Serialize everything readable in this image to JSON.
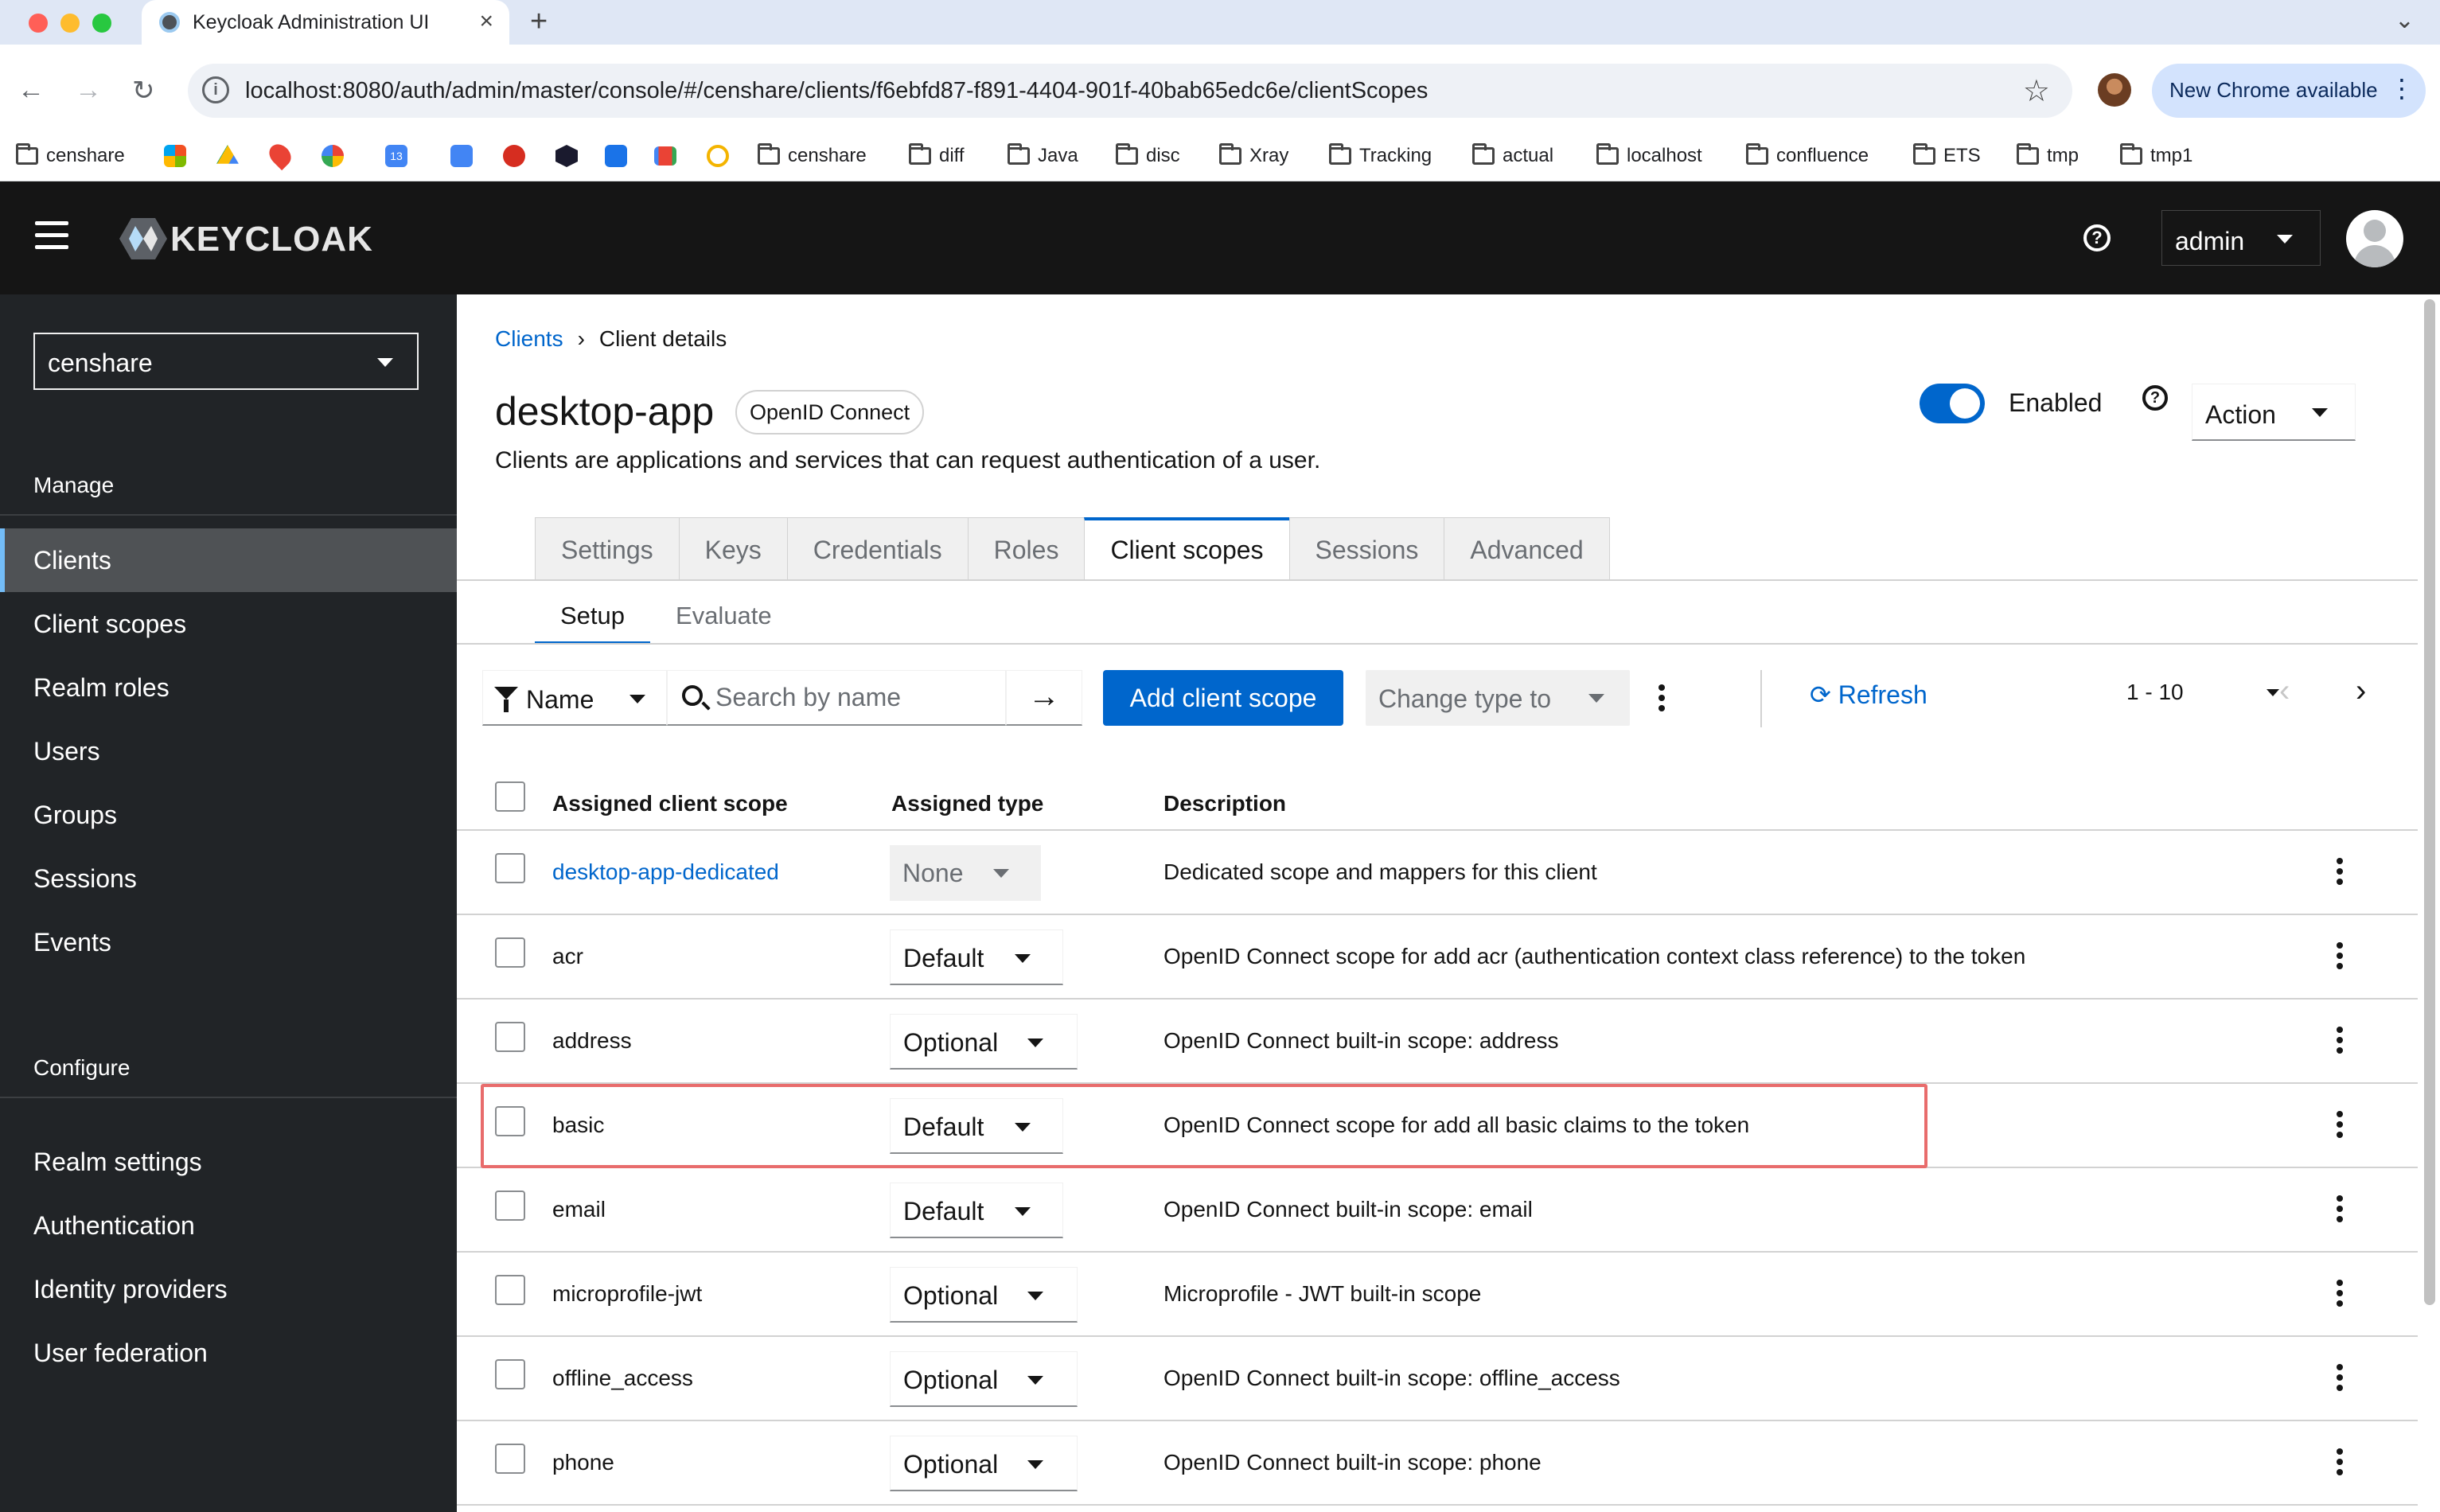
{
  "browser": {
    "tab_title": "Keycloak Administration UI",
    "url": "localhost:8080/auth/admin/master/console/#/censhare/clients/f6ebfd87-f891-4404-901f-40bab65edc6e/clientScopes",
    "update_label": "New Chrome available",
    "bookmarks": [
      "censhare",
      "censhare",
      "diff",
      "Java",
      "disc",
      "Xray",
      "Tracking",
      "actual",
      "localhost",
      "confluence",
      "ETS",
      "tmp",
      "tmp1"
    ]
  },
  "header": {
    "logo_text": "KEYCLOAK",
    "user_label": "admin"
  },
  "sidebar": {
    "realm": "censhare",
    "manage_label": "Manage",
    "manage_items": [
      "Clients",
      "Client scopes",
      "Realm roles",
      "Users",
      "Groups",
      "Sessions",
      "Events"
    ],
    "configure_label": "Configure",
    "configure_items": [
      "Realm settings",
      "Authentication",
      "Identity providers",
      "User federation"
    ]
  },
  "main": {
    "breadcrumb": {
      "root": "Clients",
      "current": "Client details"
    },
    "title": "desktop-app",
    "protocol_badge": "OpenID Connect",
    "description": "Clients are applications and services that can request authentication of a user.",
    "enabled_label": "Enabled",
    "action_label": "Action",
    "tabs": [
      "Settings",
      "Keys",
      "Credentials",
      "Roles",
      "Client scopes",
      "Sessions",
      "Advanced"
    ],
    "subtabs": [
      "Setup",
      "Evaluate"
    ],
    "toolbar": {
      "filter_label": "Name",
      "search_placeholder": "Search by name",
      "add_label": "Add client scope",
      "change_type_label": "Change type to",
      "refresh_label": "Refresh",
      "pagination": "1 - 10"
    },
    "table": {
      "headers": [
        "Assigned client scope",
        "Assigned type",
        "Description"
      ],
      "rows": [
        {
          "name": "desktop-app-dedicated",
          "type": "None",
          "description": "Dedicated scope and mappers for this client"
        },
        {
          "name": "acr",
          "type": "Default",
          "description": "OpenID Connect scope for add acr (authentication context class reference) to the token"
        },
        {
          "name": "address",
          "type": "Optional",
          "description": "OpenID Connect built-in scope: address"
        },
        {
          "name": "basic",
          "type": "Default",
          "description": "OpenID Connect scope for add all basic claims to the token"
        },
        {
          "name": "email",
          "type": "Default",
          "description": "OpenID Connect built-in scope: email"
        },
        {
          "name": "microprofile-jwt",
          "type": "Optional",
          "description": "Microprofile - JWT built-in scope"
        },
        {
          "name": "offline_access",
          "type": "Optional",
          "description": "OpenID Connect built-in scope: offline_access"
        },
        {
          "name": "phone",
          "type": "Optional",
          "description": "OpenID Connect built-in scope: phone"
        }
      ]
    }
  },
  "colors": {
    "accent": "#0066cc",
    "highlight": "#e86c6c",
    "sidebar": "#212427",
    "header": "#151515"
  }
}
